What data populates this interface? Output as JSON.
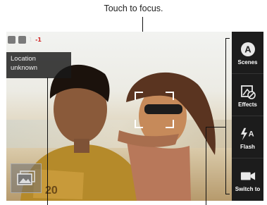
{
  "annotation": {
    "touch_to_focus": "Touch to focus."
  },
  "status_bar": {
    "number": "1",
    "suffix": "-1"
  },
  "location": {
    "line1": "Location",
    "line2": "unknown"
  },
  "sidebar": {
    "items": [
      {
        "label": "Scenes",
        "icon": "scenes-icon"
      },
      {
        "label": "Effects",
        "icon": "effects-icon"
      },
      {
        "label": "Flash",
        "icon": "flash-icon"
      },
      {
        "label": "Switch to",
        "icon": "video-camera-icon"
      }
    ]
  },
  "colors": {
    "callout_line": "#111111",
    "sidebar_bg": "#1c1c1c",
    "highlight": "#d02020"
  }
}
